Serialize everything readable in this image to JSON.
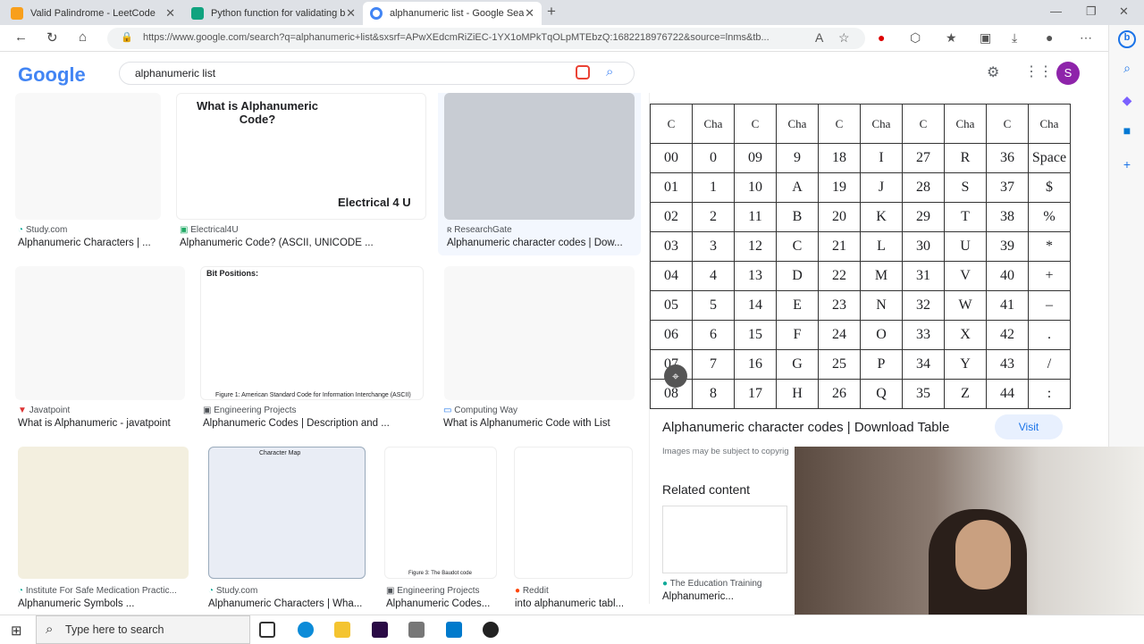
{
  "tabs": [
    {
      "title": "Valid Palindrome - LeetCode",
      "color": "#f89f1b"
    },
    {
      "title": "Python function for validating b",
      "color": "#10a37f"
    },
    {
      "title": "alphanumeric list - Google Searc",
      "color": "#4285f4"
    }
  ],
  "address": {
    "url": "https://www.google.com/search?q=alphanumeric+list&sxsrf=APwXEdcmRiZiEC-1YX1oMPkTqOLpMTEbzQ:1682218976722&source=lnms&tb..."
  },
  "search": {
    "query": "alphanumeric list"
  },
  "header": {
    "logo": "Google",
    "avatar": "S"
  },
  "results": [
    {
      "source": "Study.com",
      "caption": "Alphanumeric Characters | ..."
    },
    {
      "source": "Electrical4U",
      "caption": "Alphanumeric Code? (ASCII, UNICODE ...",
      "thumb_title": "What is Alphanumeric Code?",
      "thumb_brand": "Electrical 4 U"
    },
    {
      "source": "ResearchGate",
      "caption": "Alphanumeric character codes | Dow..."
    },
    {
      "source": "Javatpoint",
      "caption": "What is Alphanumeric - javatpoint"
    },
    {
      "source": "Engineering Projects",
      "caption": "Alphanumeric Codes | Description and ...",
      "thumb_title": "Bit Positions:",
      "thumb_footer": "Figure 1: American Standard Code for Information Interchange (ASCII)"
    },
    {
      "source": "Computing Way",
      "caption": "What is Alphanumeric Code with List"
    },
    {
      "source": "Institute For Safe Medication Practic...",
      "caption": "Alphanumeric Symbols ..."
    },
    {
      "source": "Study.com",
      "caption": "Alphanumeric Characters | Wha...",
      "thumb_title": "Character Map"
    },
    {
      "source": "Engineering Projects",
      "caption": "Alphanumeric Codes...",
      "thumb_footer": "Figure 3: The Baudot code"
    },
    {
      "source": "Reddit",
      "caption": "into alphanumeric tabl..."
    }
  ],
  "panel": {
    "header": [
      "C",
      "Cha",
      "C",
      "Cha",
      "C",
      "Cha",
      "C",
      "Cha",
      "C",
      "Cha"
    ],
    "rows": [
      [
        "00",
        "0",
        "09",
        "9",
        "18",
        "I",
        "27",
        "R",
        "36",
        "Space"
      ],
      [
        "01",
        "1",
        "10",
        "A",
        "19",
        "J",
        "28",
        "S",
        "37",
        "$"
      ],
      [
        "02",
        "2",
        "11",
        "B",
        "20",
        "K",
        "29",
        "T",
        "38",
        "%"
      ],
      [
        "03",
        "3",
        "12",
        "C",
        "21",
        "L",
        "30",
        "U",
        "39",
        "*"
      ],
      [
        "04",
        "4",
        "13",
        "D",
        "22",
        "M",
        "31",
        "V",
        "40",
        "+"
      ],
      [
        "05",
        "5",
        "14",
        "E",
        "23",
        "N",
        "32",
        "W",
        "41",
        "–"
      ],
      [
        "06",
        "6",
        "15",
        "F",
        "24",
        "O",
        "33",
        "X",
        "42",
        "."
      ],
      [
        "07",
        "7",
        "16",
        "G",
        "25",
        "P",
        "34",
        "Y",
        "43",
        "/"
      ],
      [
        "08",
        "8",
        "17",
        "H",
        "26",
        "Q",
        "35",
        "Z",
        "44",
        ":"
      ]
    ],
    "title": "Alphanumeric character codes | Download Table",
    "visit": "Visit",
    "note": "Images may be subject to copyrig",
    "related_heading": "Related content",
    "related_source": "The Education Training",
    "related_caption": "Alphanumeric..."
  },
  "taskbar": {
    "search_placeholder": "Type here to search"
  }
}
